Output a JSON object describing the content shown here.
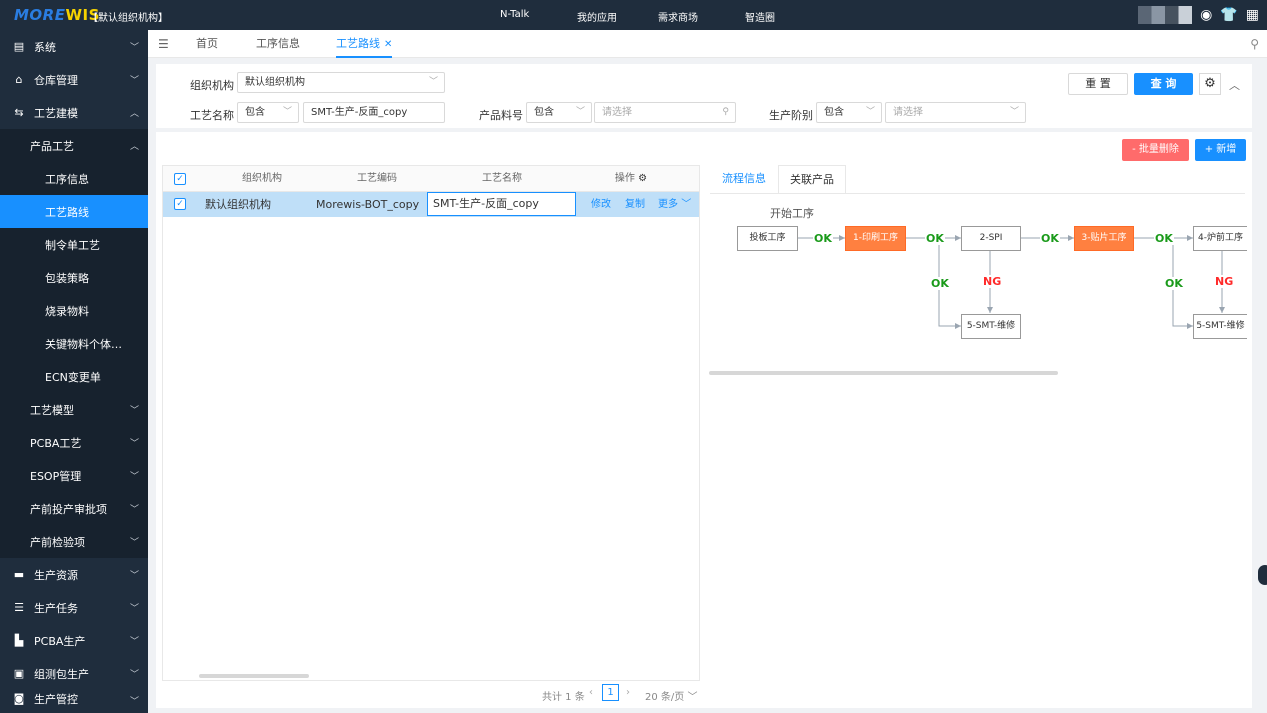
{
  "topbar": {
    "logo_part1": "MORE",
    "logo_part2": "WIS",
    "org": "【默认组织机构】",
    "nav": [
      "N-Talk",
      "我的应用",
      "需求商场",
      "智造圈"
    ]
  },
  "sidebar": {
    "items": [
      {
        "label": "系统",
        "icon": "system-icon"
      },
      {
        "label": "仓库管理",
        "icon": "warehouse-icon"
      },
      {
        "label": "工艺建模",
        "icon": "process-model-icon"
      },
      {
        "label": "产品工艺"
      },
      {
        "label": "工序信息"
      },
      {
        "label": "工艺路线"
      },
      {
        "label": "制令单工艺"
      },
      {
        "label": "包装策略"
      },
      {
        "label": "烧录物料"
      },
      {
        "label": "关键物料个体…"
      },
      {
        "label": "ECN变更单"
      },
      {
        "label": "工艺模型"
      },
      {
        "label": "PCBA工艺"
      },
      {
        "label": "ESOP管理"
      },
      {
        "label": "产前投产审批项"
      },
      {
        "label": "产前检验项"
      },
      {
        "label": "生产资源",
        "icon": "resource-icon"
      },
      {
        "label": "生产任务",
        "icon": "task-icon"
      },
      {
        "label": "PCBA生产",
        "icon": "pcba-icon"
      },
      {
        "label": "组测包生产",
        "icon": "assembly-icon"
      },
      {
        "label": "生产管控",
        "icon": "control-icon"
      }
    ]
  },
  "tabs": [
    "首页",
    "工序信息",
    "工艺路线"
  ],
  "filter": {
    "org_label": "组织机构",
    "org_value": "默认组织机构",
    "route_name_label": "工艺名称",
    "route_name_op": "包含",
    "route_name_value": "SMT-生产-反面_copy",
    "part_no_label": "产品料号",
    "part_no_op": "包含",
    "part_no_placeholder": "请选择",
    "stage_label": "生产阶别",
    "stage_op": "包含",
    "stage_placeholder": "请选择",
    "reset": "重 置",
    "query": "查 询"
  },
  "actions": {
    "batch_delete": "- 批量删除",
    "add": "+ 新增"
  },
  "table": {
    "headers": [
      "组织机构",
      "工艺编码",
      "工艺名称",
      "操作"
    ],
    "row": {
      "org": "默认组织机构",
      "code": "Morewis-BOT_copy",
      "name": "SMT-生产-反面_copy",
      "edit": "修改",
      "copy": "复制",
      "more": "更多"
    },
    "pager": {
      "total": "共计 1 条",
      "page": "1",
      "size": "20 条/页"
    }
  },
  "detail": {
    "tabs": [
      "流程信息",
      "关联产品"
    ],
    "flow_title": "开始工序",
    "nodes": [
      "投板工序",
      "1-印刷工序",
      "2-SPI",
      "3-贴片工序",
      "4-炉前工序",
      "5-SMT-维修",
      "5-SMT-维修"
    ],
    "edge_ok": "OK",
    "edge_ng": "NG"
  },
  "colors": {
    "primary": "#1890ff",
    "sidebar_bg": "#1f2d3d",
    "danger": "#ff6b6b",
    "node_orange": "#ff8040",
    "ok_green": "#1a9a1a",
    "ng_red": "#ff2a2a"
  }
}
